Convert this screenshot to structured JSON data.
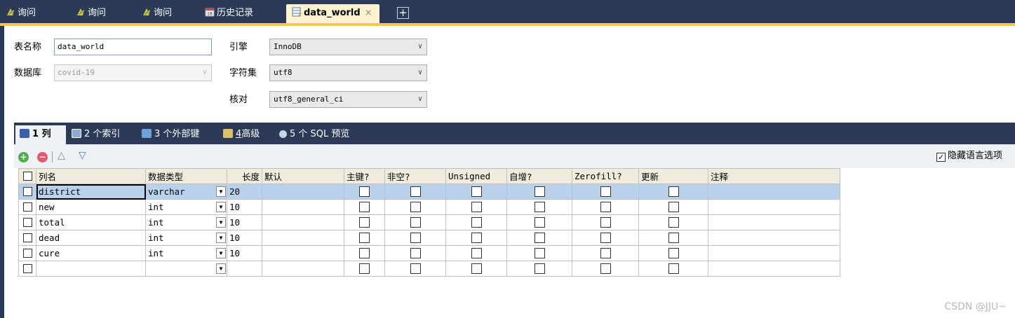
{
  "tabs": [
    {
      "label": "询问",
      "icon": "query-icon"
    },
    {
      "label": "询问",
      "icon": "query-icon"
    },
    {
      "label": "询问",
      "icon": "query-icon"
    },
    {
      "label": "历史记录",
      "icon": "history-icon"
    },
    {
      "label": "data_world",
      "icon": "table-design-icon",
      "active": true,
      "close": "×"
    }
  ],
  "add_tab": "+",
  "form": {
    "table_name_label": "表名称",
    "table_name_value": "data_world",
    "database_label": "数据库",
    "database_value": "covid-19",
    "engine_label": "引擎",
    "engine_value": "InnoDB",
    "charset_label": "字符集",
    "charset_value": "utf8",
    "collation_label": "核对",
    "collation_value": "utf8_general_ci",
    "dropdown_arrow": "∨"
  },
  "inner_tabs": [
    {
      "num": "1",
      "label": "列",
      "active": true
    },
    {
      "num": "2",
      "label": "个索引"
    },
    {
      "num": "3",
      "label": "个外部键"
    },
    {
      "num": "4",
      "label": "高级"
    },
    {
      "num": "5",
      "label": "个 SQL 预览"
    }
  ],
  "toolbar": {
    "add_symbol": "+",
    "remove_symbol": "−",
    "up_symbol": "△",
    "down_symbol": "▽",
    "hide_lang_label": "隐藏语言选项",
    "hide_lang_check": "✓"
  },
  "grid": {
    "headers": [
      "列名",
      "数据类型",
      "长度",
      "默认",
      "主键?",
      "非空?",
      "Unsigned",
      "自增?",
      "Zerofill?",
      "更新",
      "注释"
    ],
    "dropdown_glyph": "▼",
    "rows": [
      {
        "name": "district",
        "type": "varchar",
        "length": "20",
        "selected": true
      },
      {
        "name": "new",
        "type": "int",
        "length": "10"
      },
      {
        "name": "total",
        "type": "int",
        "length": "10"
      },
      {
        "name": "dead",
        "type": "int",
        "length": "10"
      },
      {
        "name": "cure",
        "type": "int",
        "length": "10"
      },
      {
        "name": "",
        "type": "",
        "length": ""
      }
    ]
  },
  "watermark": "CSDN @JJU~",
  "colors": {
    "titlebar": "#2b3a57",
    "active_tab": "#fff3cf",
    "accent": "#f6c94a",
    "selection": "#b9d1ea",
    "header": "#f0ebdc"
  }
}
